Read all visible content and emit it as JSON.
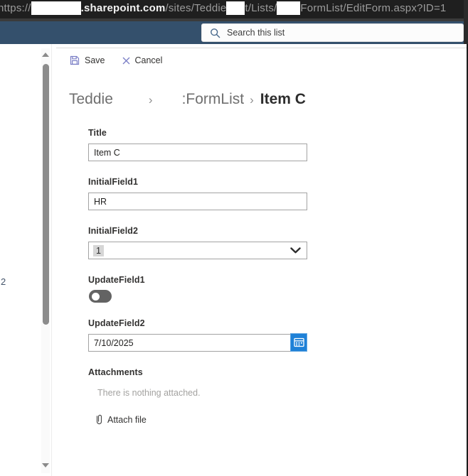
{
  "browser": {
    "url_scheme": "https://",
    "url_domain": ".sharepoint.com",
    "url_path_a": "/sites/Teddie",
    "url_path_b": "t/Lists/",
    "url_path_c": "FormList/EditForm.aspx?ID=1"
  },
  "suite_bar": {
    "search_placeholder": "Search this list"
  },
  "command_bar": {
    "save_label": "Save",
    "cancel_label": "Cancel"
  },
  "breadcrumb": {
    "site": "Teddie",
    "separator": "›",
    "list": ":FormList",
    "item": "Item C"
  },
  "page_margin": {
    "cutoff_text": "2"
  },
  "form": {
    "fields": [
      {
        "label": "Title",
        "type": "text",
        "value": "Item C"
      },
      {
        "label": "InitialField1",
        "type": "text",
        "value": "HR"
      },
      {
        "label": "InitialField2",
        "type": "dropdown",
        "value": "1"
      },
      {
        "label": "UpdateField1",
        "type": "toggle",
        "value": "off"
      },
      {
        "label": "UpdateField2",
        "type": "date",
        "value": "7/10/2025"
      }
    ],
    "attachments_label": "Attachments",
    "attachments_empty": "There is nothing attached.",
    "attach_file_label": "Attach file"
  },
  "colors": {
    "accent_icon": "#7b7fc6",
    "suite_bar_bg": "#34506c",
    "url_bar_bg": "#1f1f1f",
    "calendar_button_bg": "#1f81d7",
    "toggle_off_bg": "#636363",
    "field_border": "#a3a3a3"
  }
}
